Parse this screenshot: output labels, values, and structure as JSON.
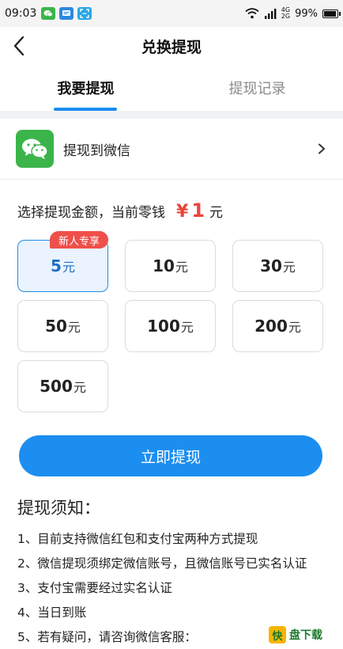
{
  "status_bar": {
    "time": "09:03",
    "network": "4G",
    "network_sub": "2G",
    "battery": "99%",
    "battery_level": 0.99
  },
  "nav": {
    "title": "兑换提现"
  },
  "tabs": [
    {
      "label": "我要提现",
      "active": true
    },
    {
      "label": "提现记录",
      "active": false
    }
  ],
  "method": {
    "label": "提现到微信",
    "icon": "wechat-icon"
  },
  "amount": {
    "prefix": "选择提现金额，当前零钱",
    "currency": "¥",
    "value": "1",
    "unit": "元"
  },
  "options": [
    {
      "num": "5",
      "unit": "元",
      "selected": true,
      "badge": "新人专享"
    },
    {
      "num": "10",
      "unit": "元",
      "selected": false
    },
    {
      "num": "30",
      "unit": "元",
      "selected": false
    },
    {
      "num": "50",
      "unit": "元",
      "selected": false
    },
    {
      "num": "100",
      "unit": "元",
      "selected": false
    },
    {
      "num": "200",
      "unit": "元",
      "selected": false
    },
    {
      "num": "500",
      "unit": "元",
      "selected": false
    }
  ],
  "button": {
    "label": "立即提现"
  },
  "notes": {
    "title": "提现须知：",
    "items": [
      "1、目前支持微信红包和支付宝两种方式提现",
      "2、微信提现须绑定微信账号，且微信账号已实名认证",
      "3、支付宝需要经过实名认证",
      "4、当日到账",
      "5、若有疑问，请咨询微信客服："
    ]
  },
  "watermark": {
    "logo": "快",
    "text": "盘下载"
  },
  "colors": {
    "accent": "#1c8ef0",
    "price": "#e8463a",
    "badge": "#ef4f4a",
    "wechat": "#3bb54a"
  }
}
